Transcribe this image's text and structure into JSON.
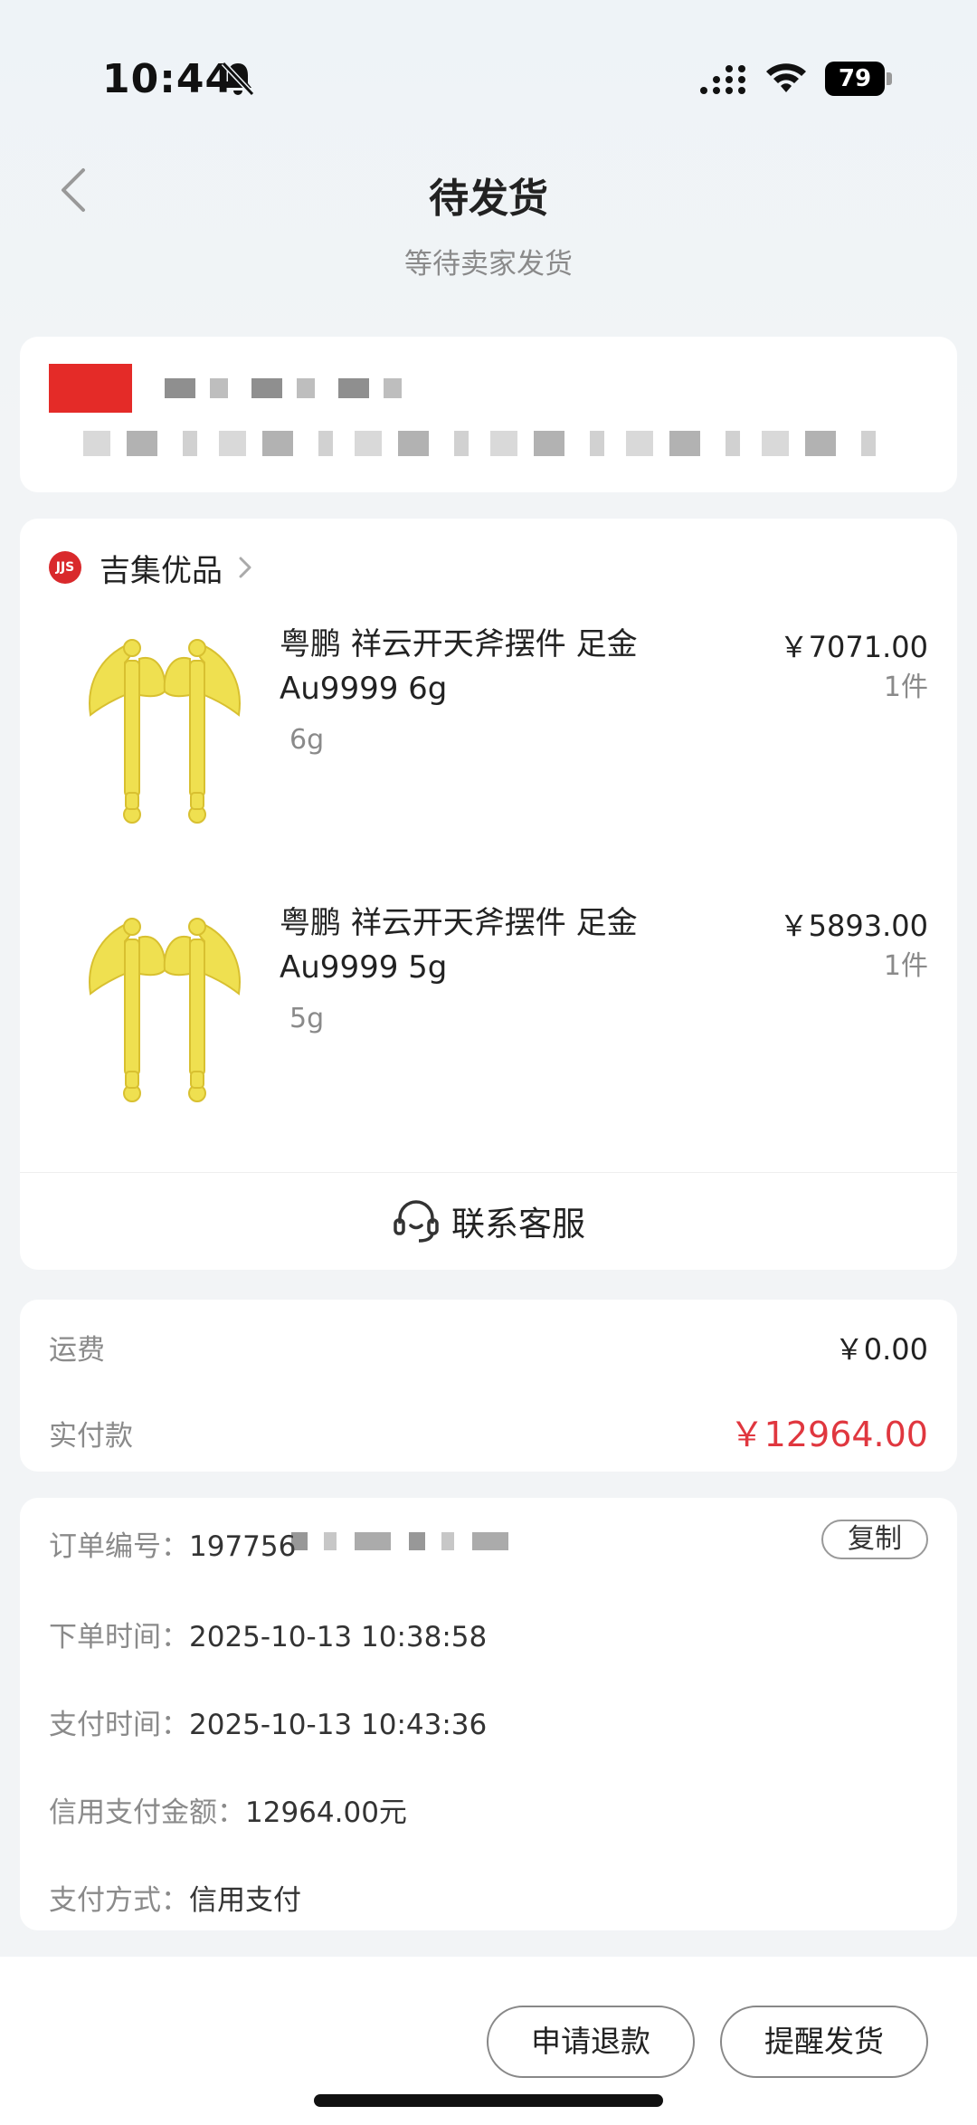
{
  "status_bar": {
    "time": "10:44",
    "battery": "79",
    "icons": [
      "bell-slash-icon",
      "signal-icon",
      "wifi-icon",
      "battery-icon"
    ]
  },
  "nav": {
    "back_icon": "chevron-left-icon",
    "title": "待发货",
    "subtitle": "等待卖家发货"
  },
  "shop": {
    "name": "吉集优品",
    "logo_text": "JJS"
  },
  "products": [
    {
      "title": "粤鹏 祥云开天斧摆件 足金 Au9999 6g",
      "spec": "6g",
      "price": "￥7071.00",
      "qty": "1件"
    },
    {
      "title": "粤鹏 祥云开天斧摆件 足金 Au9999 5g",
      "spec": "5g",
      "price": "￥5893.00",
      "qty": "1件"
    }
  ],
  "customer_service": {
    "label": "联系客服",
    "icon": "headset-icon"
  },
  "fees": {
    "shipping_label": "运费",
    "shipping_value": "￥0.00",
    "paid_label": "实付款",
    "paid_value": "￥12964.00"
  },
  "order_info": {
    "order_no_label": "订单编号：",
    "order_no_value": "197756",
    "copy_label": "复制",
    "order_time_label": "下单时间：",
    "order_time_value": "2025-10-13 10:38:58",
    "pay_time_label": "支付时间：",
    "pay_time_value": "2025-10-13 10:43:36",
    "credit_amount_label": "信用支付金额：",
    "credit_amount_value": "12964.00元",
    "pay_method_label": "支付方式：",
    "pay_method_value": "信用支付"
  },
  "actions": {
    "refund": "申请退款",
    "remind": "提醒发货"
  },
  "colors": {
    "accent_red": "#e0373f",
    "gold": "#efe050"
  }
}
